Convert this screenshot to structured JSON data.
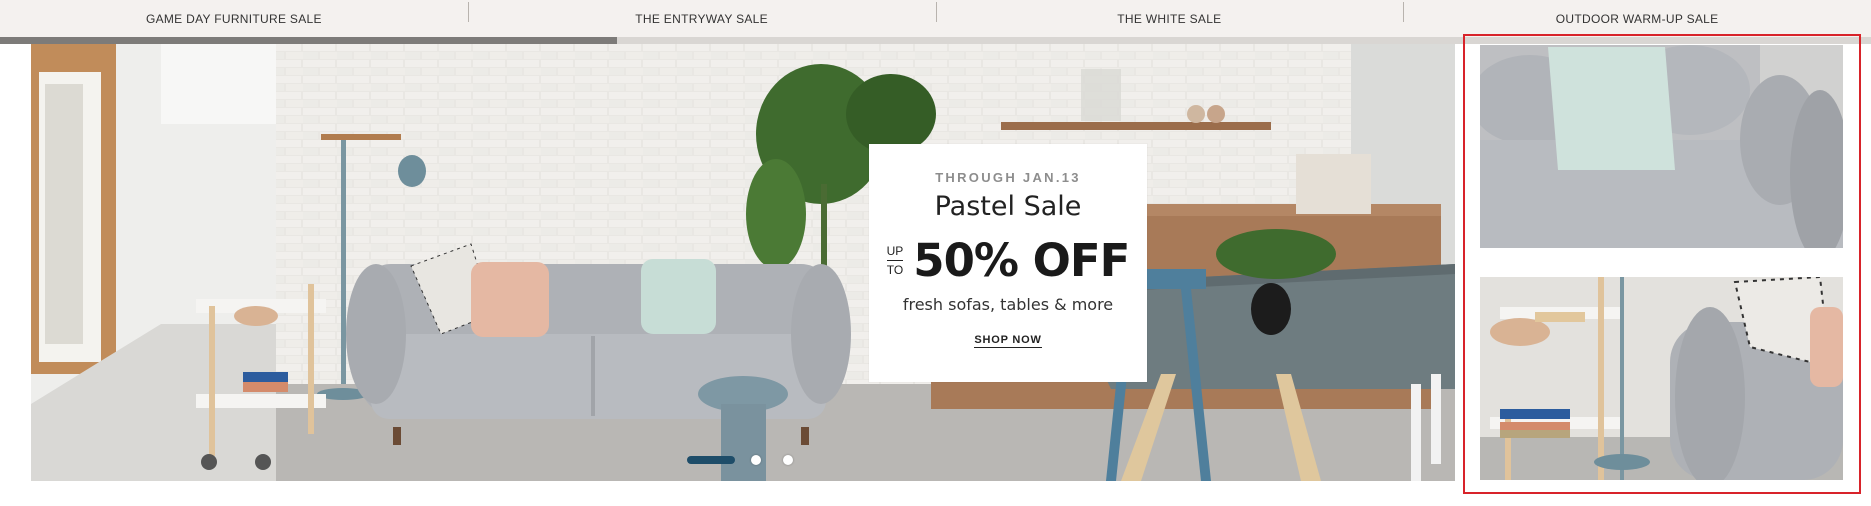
{
  "nav": {
    "tabs": [
      {
        "label": "GAME DAY FURNITURE SALE"
      },
      {
        "label": "THE ENTRYWAY SALE"
      },
      {
        "label": "THE WHITE SALE"
      },
      {
        "label": "OUTDOOR WARM-UP SALE"
      }
    ]
  },
  "carousel": {
    "progress_fraction": 0.33,
    "slides_count_visible": 3,
    "active_slide_index": 0
  },
  "promo": {
    "date": "THROUGH JAN.13",
    "title": "Pastel Sale",
    "up": "UP",
    "to": "TO",
    "percent": "50% OFF",
    "description": "fresh sofas, tables & more",
    "cta": "SHOP NOW"
  },
  "side_tiles": [
    {
      "name": "sofa-cushion-detail"
    },
    {
      "name": "bar-cart-detail"
    }
  ],
  "colors": {
    "nav_bg": "#f4f1ef",
    "progress_fill": "#7d7b79",
    "dot_active": "#1e4d69",
    "highlight": "#d8232a"
  }
}
